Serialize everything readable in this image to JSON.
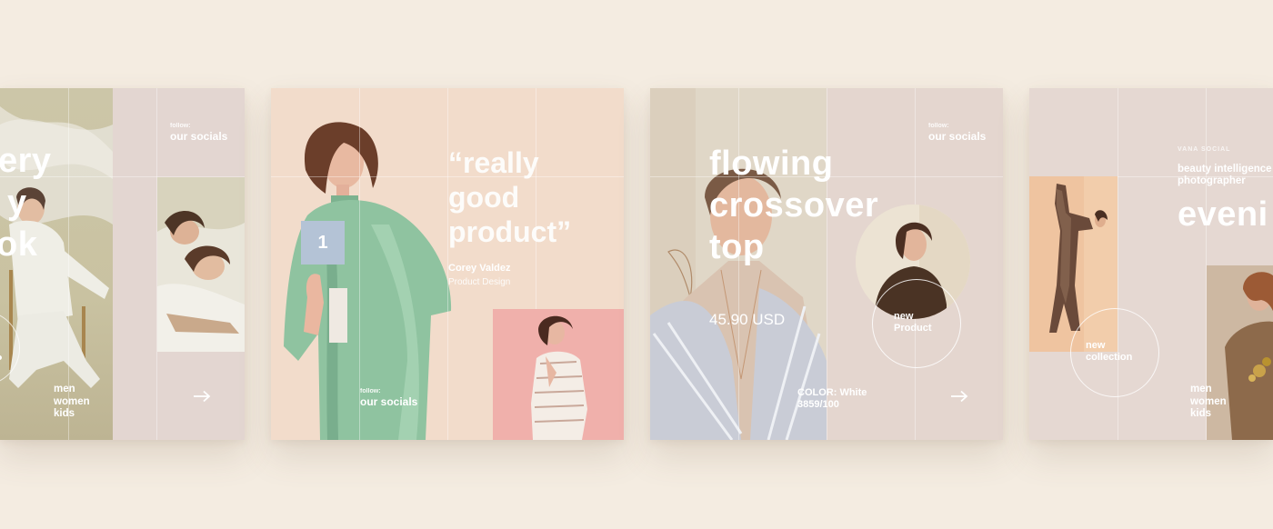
{
  "cards": [
    {
      "headline_lines": [
        "ery",
        "y",
        "ok"
      ],
      "follow_label": "follow:",
      "socials_label": "our socials",
      "nav_items": [
        "men",
        "women",
        "kids"
      ]
    },
    {
      "badge_number": "1",
      "quote_lines": [
        "“really",
        "good",
        "product”"
      ],
      "author_name": "Corey Valdez",
      "author_role": "Product Design",
      "follow_label": "follow:",
      "socials_label": "our socials"
    },
    {
      "headline_lines": [
        "flowing",
        "crossover",
        "top"
      ],
      "price": "45.90 USD",
      "follow_label": "follow:",
      "socials_label": "our socials",
      "circle_label_lines": [
        "new",
        "Product"
      ],
      "color_label": "COLOR: White",
      "code_label": "3859/100"
    },
    {
      "brand_label": "VANA SOCIAL",
      "tagline_lines": [
        "beauty intelligence",
        "photographer"
      ],
      "headline": "eveni",
      "circle_label_lines": [
        "new",
        "collection"
      ],
      "nav_items": [
        "men",
        "women",
        "kids"
      ]
    }
  ],
  "colors": {
    "page_background": "#f4ece1",
    "card_blush": "#e6d8d0",
    "card_peach": "#f2dccb",
    "photo_pink": "#efaeaa",
    "coat_green": "#8fc3a0",
    "badge_blue": "#b4c3d6"
  }
}
